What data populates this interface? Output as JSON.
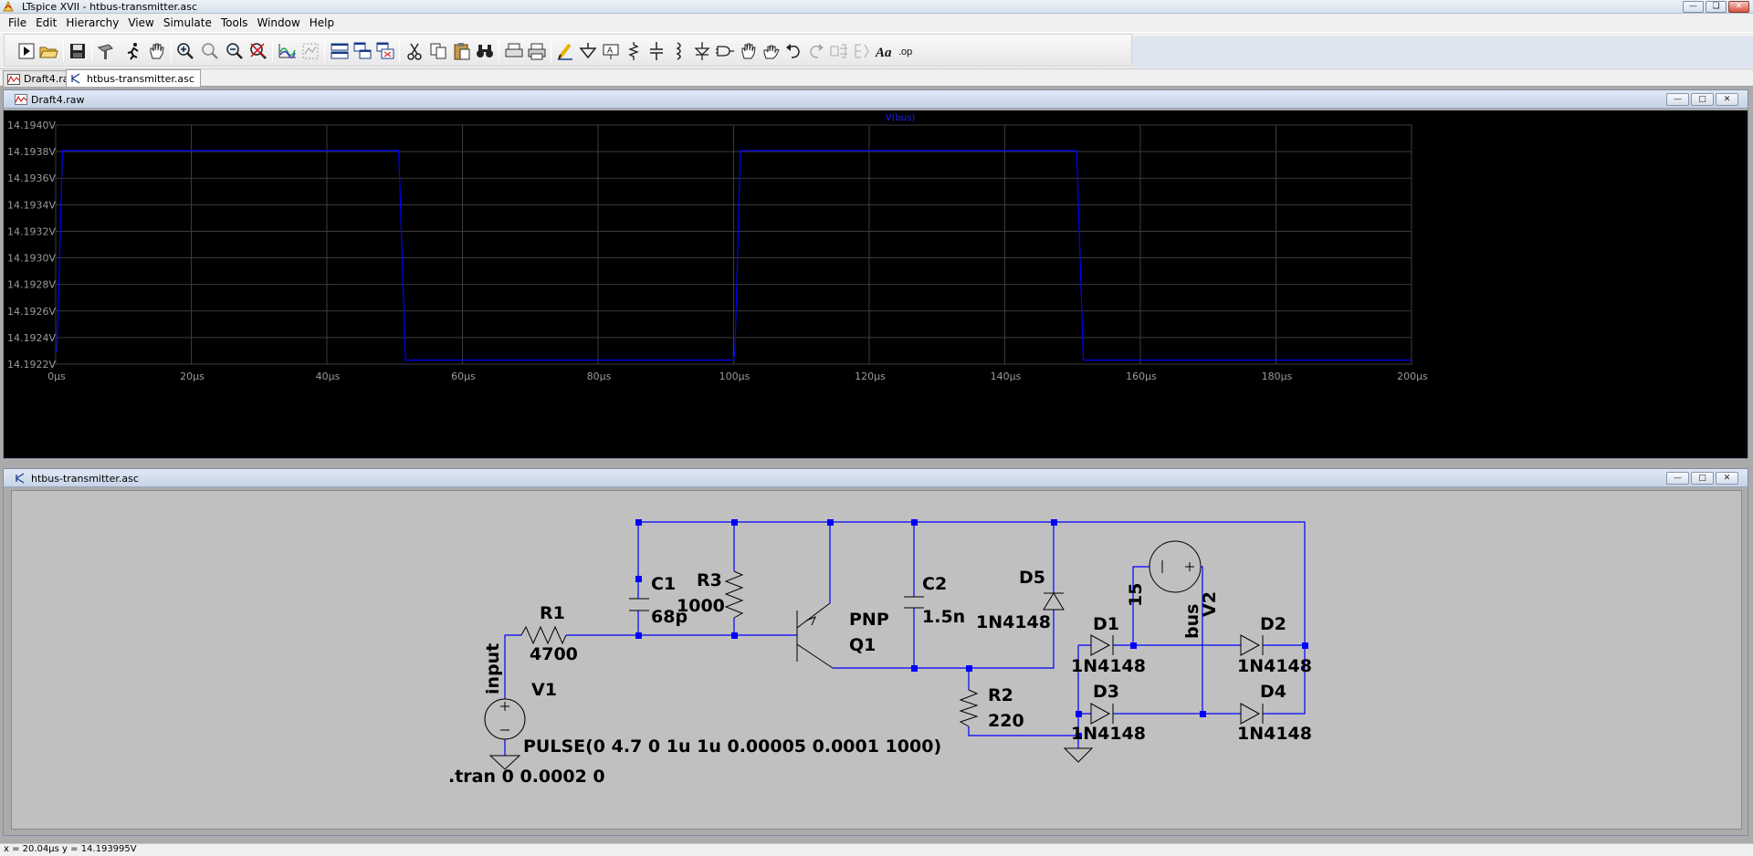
{
  "window": {
    "title": "LTspice XVII - htbus-transmitter.asc"
  },
  "menu": [
    "File",
    "Edit",
    "Hierarchy",
    "View",
    "Simulate",
    "Tools",
    "Window",
    "Help"
  ],
  "toolbar_icons": [
    "run-icon",
    "open-icon",
    "save-icon",
    "control-panel-icon",
    "run-simulation-icon",
    "pan-icon",
    "zoom-in-icon",
    "zoom-back-icon",
    "zoom-out-icon",
    "zoom-cancel-icon",
    "autorange-icon",
    "add-trace-icon",
    "tile-horizontal-icon",
    "cascade-icon",
    "close-window-icon",
    "cut-icon",
    "copy-icon",
    "paste-icon",
    "find-icon",
    "print-setup-icon",
    "print-icon",
    "draw-wire-icon",
    "ground-icon",
    "label-net-icon",
    "resistor-icon",
    "capacitor-icon",
    "inductor-icon",
    "diode-icon",
    "component-icon",
    "move-icon",
    "drag-icon",
    "undo-icon",
    "redo-icon",
    "rotate-icon",
    "mirror-icon",
    "text-icon",
    "spice-directive-icon"
  ],
  "tabs": [
    {
      "label": "Draft4.raw",
      "icon": "waveform-icon"
    },
    {
      "label": "htbus-transmitter.asc",
      "icon": "schematic-icon"
    }
  ],
  "waveform_window": {
    "title": "Draft4.raw"
  },
  "schematic_window": {
    "title": "htbus-transmitter.asc"
  },
  "chart_data": {
    "type": "line",
    "title": "V(bus)",
    "xlabel": "",
    "ylabel": "",
    "x_ticks": [
      "0µs",
      "20µs",
      "40µs",
      "60µs",
      "80µs",
      "100µs",
      "120µs",
      "140µs",
      "160µs",
      "180µs",
      "200µs"
    ],
    "y_ticks": [
      "14.1940V",
      "14.1938V",
      "14.1936V",
      "14.1934V",
      "14.1932V",
      "14.1930V",
      "14.1928V",
      "14.1926V",
      "14.1924V",
      "14.1922V"
    ],
    "xlim": [
      0,
      200
    ],
    "ylim": [
      14.19222,
      14.194
    ],
    "grid": true,
    "series": [
      {
        "name": "V(bus)",
        "color": "#0000ff",
        "x": [
          0,
          0.2,
          1.0,
          50.6,
          51.6,
          100,
          100.2,
          101.0,
          150.6,
          151.6,
          200
        ],
        "y": [
          14.19231,
          14.19232,
          14.19381,
          14.19381,
          14.19225,
          14.19225,
          14.19232,
          14.19381,
          14.19381,
          14.19225,
          14.19225
        ]
      }
    ]
  },
  "schematic": {
    "components": [
      {
        "ref": "R1",
        "value": "4700"
      },
      {
        "ref": "R2",
        "value": "220"
      },
      {
        "ref": "R3",
        "value": "1000"
      },
      {
        "ref": "C1",
        "value": "68p"
      },
      {
        "ref": "C2",
        "value": "1.5n"
      },
      {
        "ref": "Q1",
        "value": "PNP"
      },
      {
        "ref": "D1",
        "value": "1N4148"
      },
      {
        "ref": "D2",
        "value": "1N4148"
      },
      {
        "ref": "D3",
        "value": "1N4148"
      },
      {
        "ref": "D4",
        "value": "1N4148"
      },
      {
        "ref": "D5",
        "value": "1N4148"
      },
      {
        "ref": "V1",
        "value": "PULSE(0 4.7 0 1u 1u 0.00005 0.0001 1000)"
      },
      {
        "ref": "V2",
        "value": "15"
      }
    ],
    "net_labels": [
      "input",
      "bus"
    ],
    "directive": ".tran 0 0.0002 0"
  },
  "status": {
    "text": "x = 20.04µs    y = 14.193995V"
  },
  "colors": {
    "trace": "#0000ff",
    "wire": "#0000ff",
    "plot_bg": "#000000",
    "schematic_bg": "#c0c0c0"
  }
}
